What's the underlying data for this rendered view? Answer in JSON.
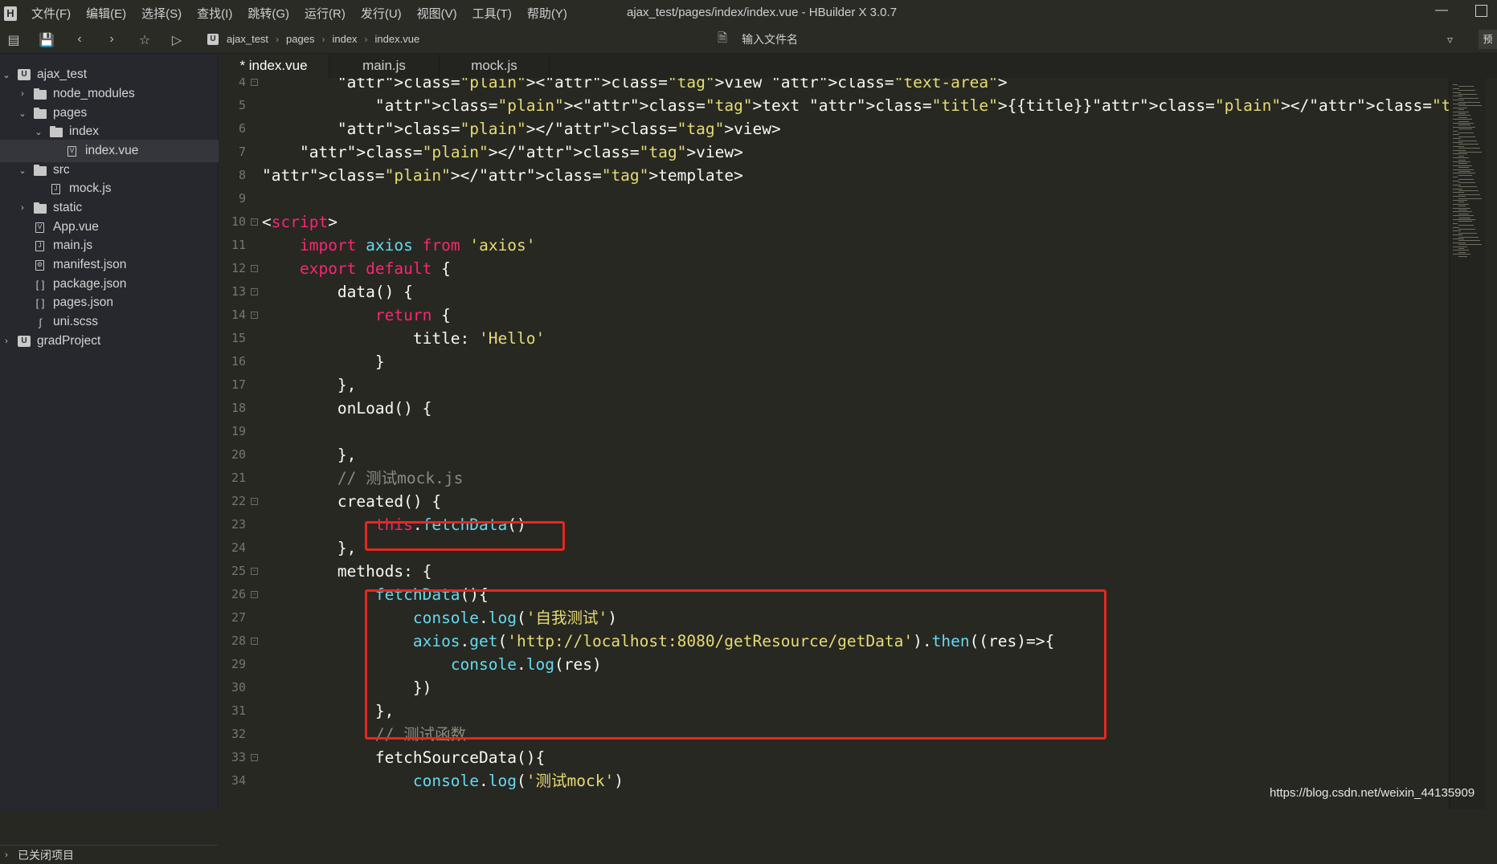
{
  "titlebar": {
    "logo": "H",
    "window_title": "ajax_test/pages/index/index.vue - HBuilder X 3.0.7",
    "menu": [
      "文件(F)",
      "编辑(E)",
      "选择(S)",
      "查找(I)",
      "跳转(G)",
      "运行(R)",
      "发行(U)",
      "视图(V)",
      "工具(T)",
      "帮助(Y)"
    ]
  },
  "toolbar": {
    "breadcrumbs": [
      "ajax_test",
      "pages",
      "index",
      "index.vue"
    ],
    "file_search_placeholder": "输入文件名",
    "right_button": "预"
  },
  "sidebar": {
    "tree": [
      {
        "label": "ajax_test",
        "kind": "project",
        "expanded": true
      },
      {
        "label": "node_modules",
        "kind": "folder",
        "expanded": false
      },
      {
        "label": "pages",
        "kind": "folder-open",
        "expanded": true
      },
      {
        "label": "index",
        "kind": "folder-open",
        "expanded": true
      },
      {
        "label": "index.vue",
        "kind": "vue-file",
        "selected": true
      },
      {
        "label": "src",
        "kind": "folder-open",
        "expanded": true
      },
      {
        "label": "mock.js",
        "kind": "js-file"
      },
      {
        "label": "static",
        "kind": "folder",
        "expanded": false
      },
      {
        "label": "App.vue",
        "kind": "vue-file"
      },
      {
        "label": "main.js",
        "kind": "js-file"
      },
      {
        "label": "manifest.json",
        "kind": "manifest-file"
      },
      {
        "label": "package.json",
        "kind": "json-file"
      },
      {
        "label": "pages.json",
        "kind": "json-file"
      },
      {
        "label": "uni.scss",
        "kind": "scss-file"
      },
      {
        "label": "gradProject",
        "kind": "project",
        "expanded": false
      }
    ],
    "closed_projects": "已关闭项目"
  },
  "tabs": [
    {
      "label": "* index.vue",
      "active": true
    },
    {
      "label": "main.js",
      "active": false
    },
    {
      "label": "mock.js",
      "active": false
    }
  ],
  "editor": {
    "lines": [
      {
        "n": "4",
        "fold": true,
        "text": "        <view class=\"text-area\">"
      },
      {
        "n": "5",
        "fold": false,
        "text": "            <text class=\"title\">{{title}}</text>"
      },
      {
        "n": "6",
        "fold": false,
        "text": "        </view>"
      },
      {
        "n": "7",
        "fold": false,
        "text": "    </view>"
      },
      {
        "n": "8",
        "fold": false,
        "text": "</template>"
      },
      {
        "n": "9",
        "fold": false,
        "text": ""
      },
      {
        "n": "10",
        "fold": true,
        "text": "<script>"
      },
      {
        "n": "11",
        "fold": false,
        "text": "    import axios from 'axios'"
      },
      {
        "n": "12",
        "fold": true,
        "text": "    export default {"
      },
      {
        "n": "13",
        "fold": true,
        "text": "        data() {"
      },
      {
        "n": "14",
        "fold": true,
        "text": "            return {"
      },
      {
        "n": "15",
        "fold": false,
        "text": "                title: 'Hello'"
      },
      {
        "n": "16",
        "fold": false,
        "text": "            }"
      },
      {
        "n": "17",
        "fold": false,
        "text": "        },"
      },
      {
        "n": "18",
        "fold": false,
        "text": "        onLoad() {"
      },
      {
        "n": "19",
        "fold": false,
        "text": ""
      },
      {
        "n": "20",
        "fold": false,
        "text": "        },"
      },
      {
        "n": "21",
        "fold": false,
        "text": "        // 测试mock.js"
      },
      {
        "n": "22",
        "fold": true,
        "text": "        created() {"
      },
      {
        "n": "23",
        "fold": false,
        "text": "            this.fetchData()"
      },
      {
        "n": "24",
        "fold": false,
        "text": "        },"
      },
      {
        "n": "25",
        "fold": true,
        "text": "        methods: {"
      },
      {
        "n": "26",
        "fold": true,
        "text": "            fetchData(){"
      },
      {
        "n": "27",
        "fold": false,
        "text": "                console.log('自我测试')"
      },
      {
        "n": "28",
        "fold": true,
        "text": "                axios.get('http://localhost:8080/getResource/getData').then((res)=>{"
      },
      {
        "n": "29",
        "fold": false,
        "text": "                    console.log(res)"
      },
      {
        "n": "30",
        "fold": false,
        "text": "                })"
      },
      {
        "n": "31",
        "fold": false,
        "text": "            },"
      },
      {
        "n": "32",
        "fold": false,
        "text": "            // 测试函数"
      },
      {
        "n": "33",
        "fold": true,
        "text": "            fetchSourceData(){"
      },
      {
        "n": "34",
        "fold": false,
        "text": "                console.log('测试mock')"
      }
    ]
  },
  "watermark": "https://blog.csdn.net/weixin_44135909",
  "colors": {
    "background": "#272822",
    "sidebar": "#27282e",
    "highlight_box": "#e8261f",
    "keyword": "#f92672",
    "string": "#e6db74",
    "function": "#66d9ef",
    "attribute": "#a6e22e"
  }
}
